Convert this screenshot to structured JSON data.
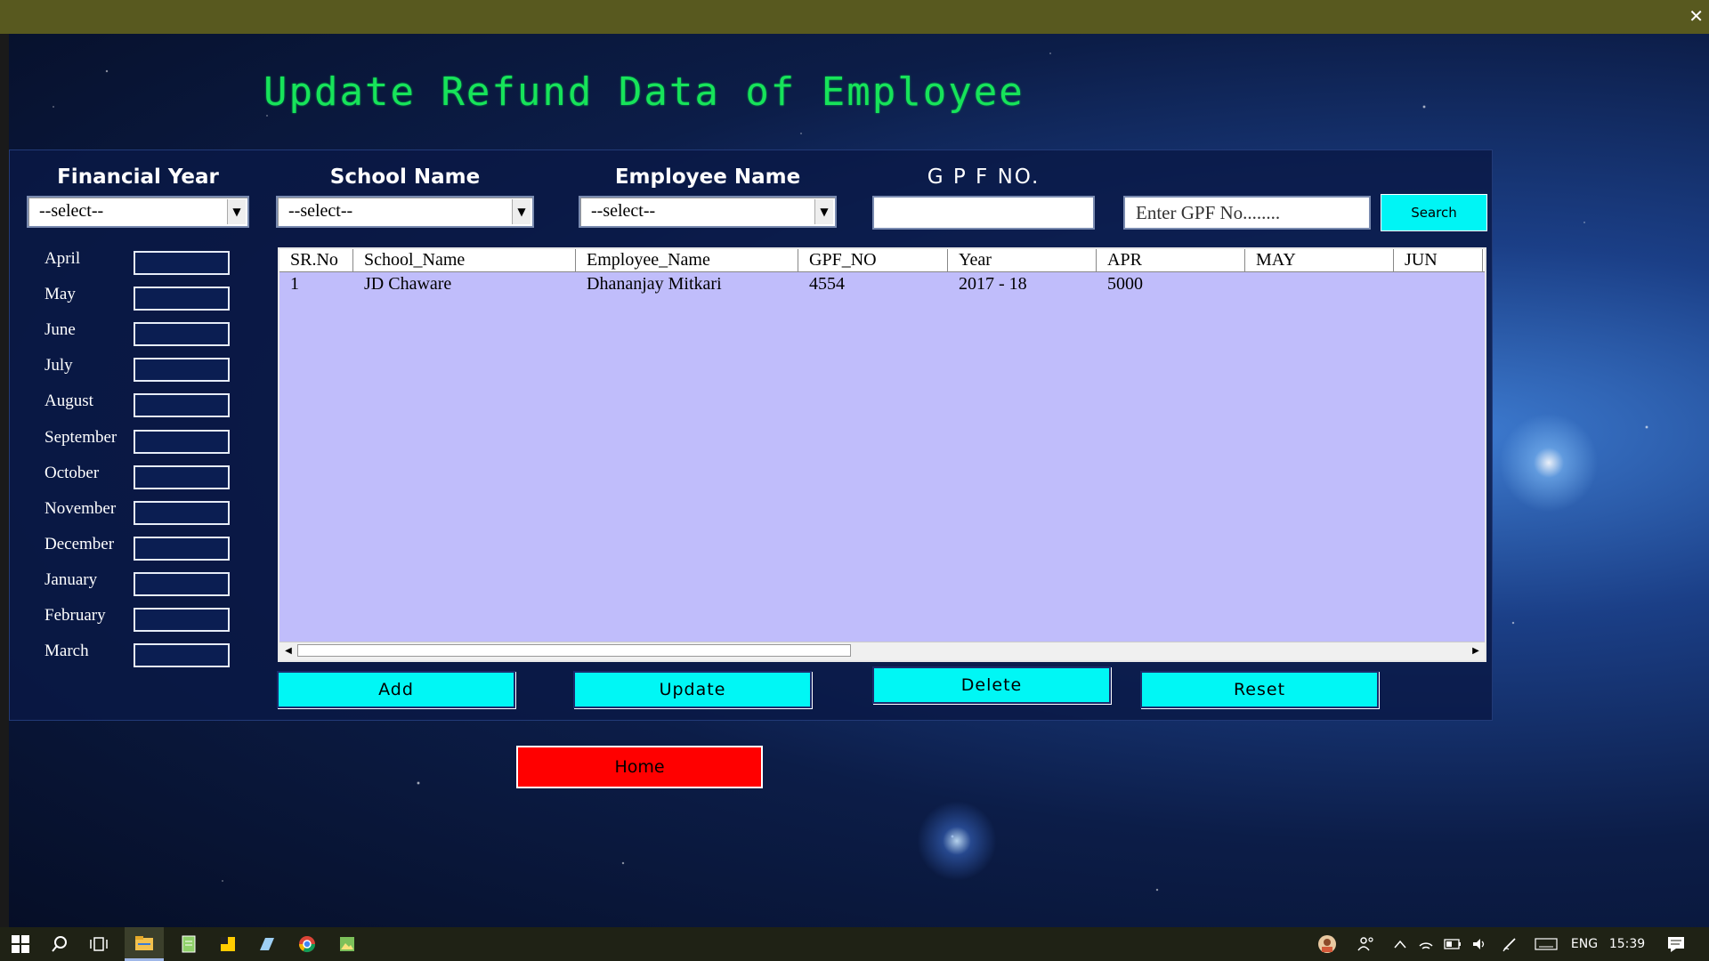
{
  "window": {
    "close_label": "✕"
  },
  "title": "Update Refund Data of Employee",
  "filters": {
    "financial_year": {
      "label": "Financial Year",
      "value": "--select--"
    },
    "school_name": {
      "label": "School Name",
      "value": "--select--"
    },
    "employee_name": {
      "label": "Employee Name",
      "value": "--select--"
    },
    "gpf_no": {
      "label": "G P F NO.",
      "value": ""
    },
    "search_input": {
      "placeholder": "Enter GPF No........"
    },
    "search_button": "Search"
  },
  "months": [
    "April",
    "May",
    "June",
    "July",
    "August",
    "September",
    "October",
    "November",
    "December",
    "January",
    "February",
    "March"
  ],
  "grid": {
    "columns": [
      "SR.No",
      "School_Name",
      "Employee_Name",
      "GPF_NO",
      "Year",
      "APR",
      "MAY",
      "JUN"
    ],
    "rows": [
      [
        "1",
        "JD Chaware",
        "Dhananjay Mitkari",
        "4554",
        "2017 - 18",
        "5000",
        "",
        ""
      ]
    ]
  },
  "actions": {
    "add": "Add",
    "update": "Update",
    "delete": "Delete",
    "reset": "Reset",
    "home": "Home"
  },
  "taskbar": {
    "icons": [
      "windows-start-icon",
      "search-icon",
      "task-view-icon",
      "file-explorer-icon",
      "notepad-icon",
      "sticky-notes-icon",
      "app-icon",
      "chrome-icon",
      "image-icon"
    ],
    "tray": {
      "language": "ENG",
      "time": "15:39"
    }
  },
  "colors": {
    "title_green": "#17e35a",
    "button_cyan": "#00f7f5",
    "home_red": "#ff0000",
    "grid_bg": "#c0bdfb"
  }
}
